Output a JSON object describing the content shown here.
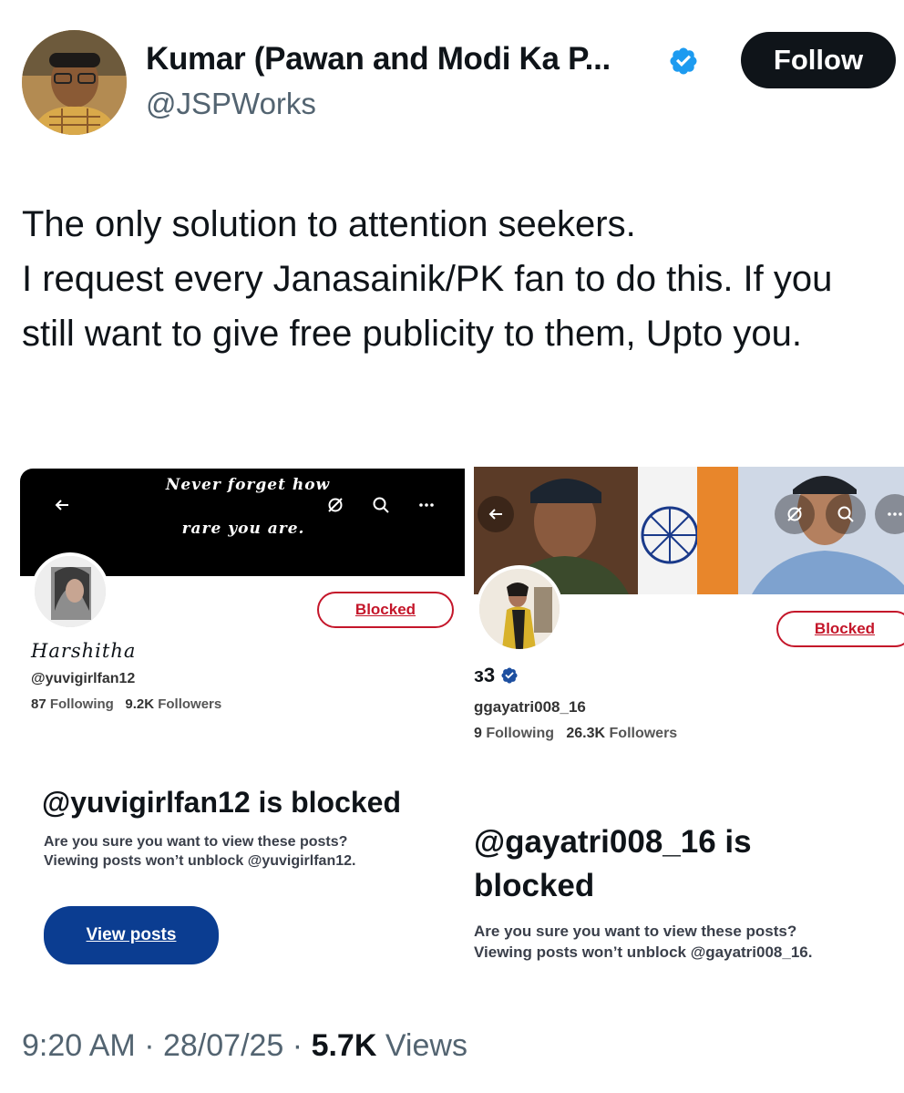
{
  "author": {
    "name": "Kumar (Pawan and Modi Ka P...",
    "handle": "@JSPWorks",
    "follow_label": "Follow"
  },
  "tweet": {
    "text": "The only solution to attention seekers.\nI request every Janasainik/PK fan to do this. If you still want to give free publicity to them, Upto you."
  },
  "screenshot_left": {
    "banner_quote_line1": "Never forget how",
    "banner_quote_line2": "rare you are.",
    "blocked_label": "Blocked",
    "display_name": "Harshitha",
    "handle": "@yuvigirlfan12",
    "following_count": "87",
    "following_label": "Following",
    "followers_count": "9.2K",
    "followers_label": "Followers",
    "blocked_title": "@yuvigirlfan12 is blocked",
    "blocked_line1": "Are you sure you want to view these posts?",
    "blocked_line2": "Viewing posts won’t unblock @yuvigirlfan12.",
    "view_posts_label": "View posts"
  },
  "screenshot_right": {
    "blocked_label": "Blocked",
    "display_name": "ɜ3",
    "handle": "ɡgayatri008_16",
    "following_count": "9",
    "following_label": "Following",
    "followers_count": "26.3K",
    "followers_label": "Followers",
    "blocked_title_line1": "@gayatri008_16 is",
    "blocked_title_line2": "blocked",
    "blocked_line1": "Are you sure you want to view these posts?",
    "blocked_line2": "Viewing posts won’t unblock @gayatri008_16."
  },
  "meta": {
    "time": "9:20 AM",
    "date": "28/07/25",
    "views_count": "5.7K",
    "views_label": "Views"
  },
  "colors": {
    "verified_blue": "#1d9bf0",
    "blocked_red": "#c4162a",
    "view_button_blue": "#0b3d91"
  }
}
